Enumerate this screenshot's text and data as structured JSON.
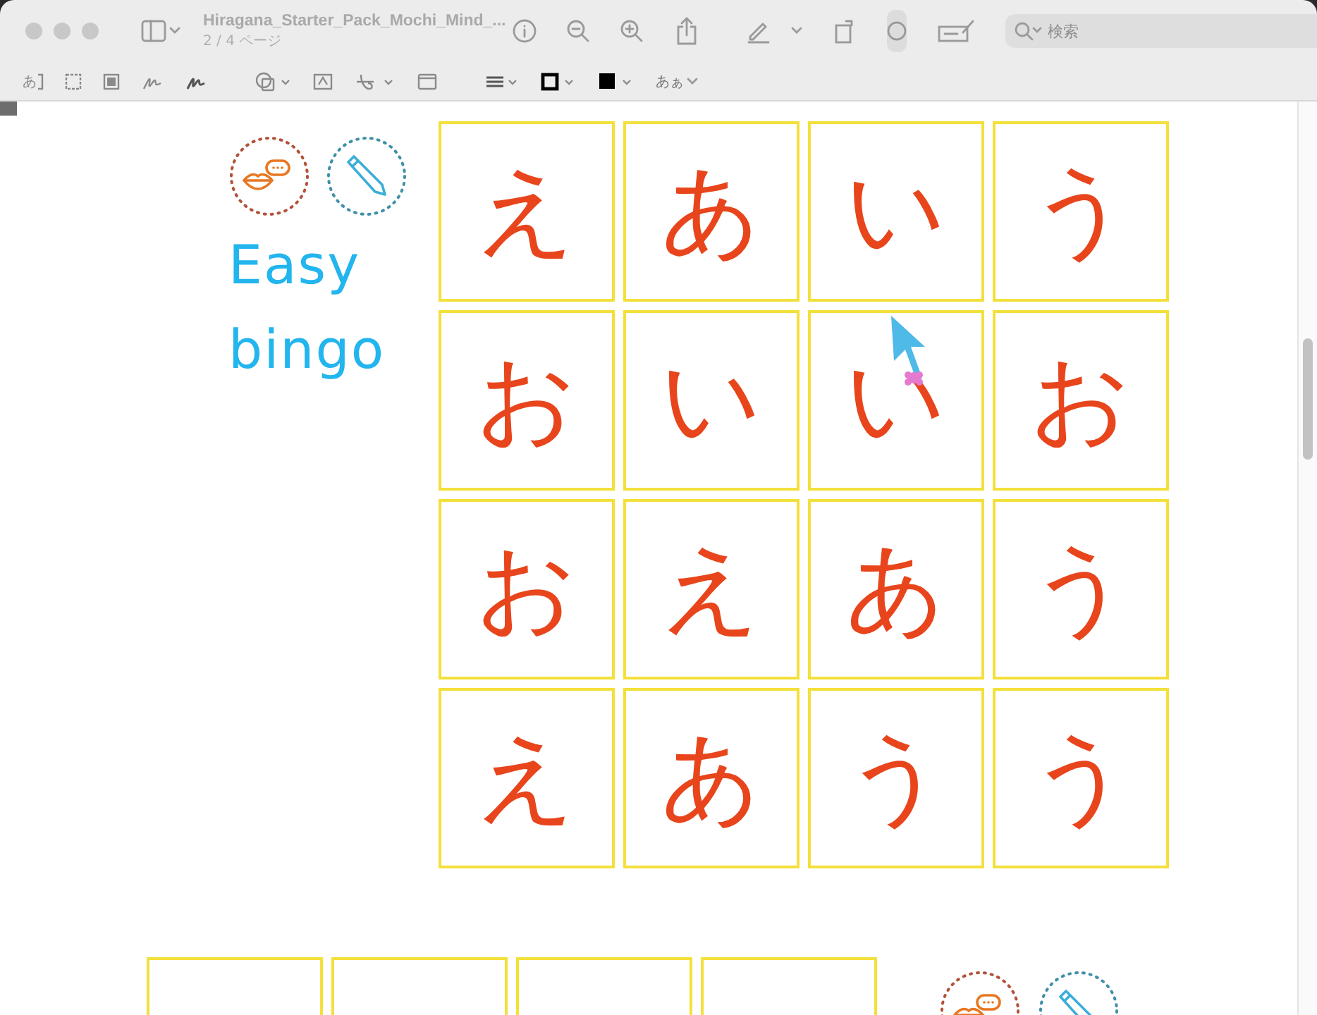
{
  "window": {
    "title": "Hiragana_Starter_Pack_Mochi_Mind_...",
    "subtitle": "2 / 4 ページ"
  },
  "search": {
    "placeholder": "検索"
  },
  "markup_toolbar": {
    "text_select": "あ",
    "font_button": "あぁ"
  },
  "page": {
    "heading": "Easy bingo",
    "cards": [
      "え",
      "あ",
      "い",
      "う",
      "お",
      "い",
      "い",
      "お",
      "お",
      "え",
      "あ",
      "う",
      "え",
      "あ",
      "う",
      "う"
    ]
  }
}
